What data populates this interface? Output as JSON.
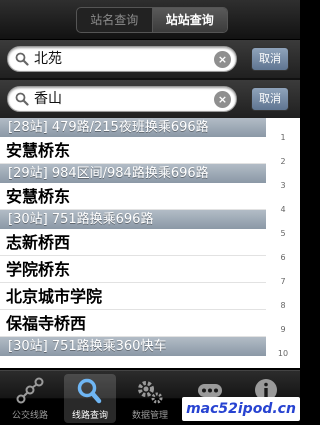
{
  "segmented": {
    "options": [
      "站名查询",
      "站站查询"
    ],
    "active": "站站查询"
  },
  "search_from": {
    "value": "北苑",
    "clear_icon": "clear-icon",
    "cancel_label": "取消"
  },
  "search_to": {
    "value": "香山",
    "clear_icon": "clear-icon",
    "cancel_label": "取消"
  },
  "results": {
    "headers": [
      "[28站] 479路/215夜班换乘696路",
      "[29站] 984区间/984路换乘696路",
      "[30站] 751路换乘696路",
      "[30站] 751路换乘360快车"
    ],
    "items": [
      "安慧桥东",
      "安慧桥东",
      "志新桥西",
      "学院桥东",
      "北京城市学院",
      "保福寺桥西"
    ],
    "index": [
      "1",
      "2",
      "3",
      "4",
      "5",
      "6",
      "7",
      "8",
      "9",
      "10"
    ]
  },
  "tabbar": {
    "tabs": [
      {
        "label": "公交线路",
        "icon": "bus-route-icon"
      },
      {
        "label": "线路查询",
        "icon": "search-icon",
        "active": true
      },
      {
        "label": "数据管理",
        "icon": "gear-icon"
      },
      {
        "label": "",
        "icon": "more-icon"
      },
      {
        "label": "",
        "icon": "info-icon"
      }
    ]
  },
  "watermark": "mac52ipod.cn",
  "colors": {
    "header_row": "#9aa5b1",
    "cancel_button": "#6f84a0",
    "watermark_text": "#2743d1"
  }
}
